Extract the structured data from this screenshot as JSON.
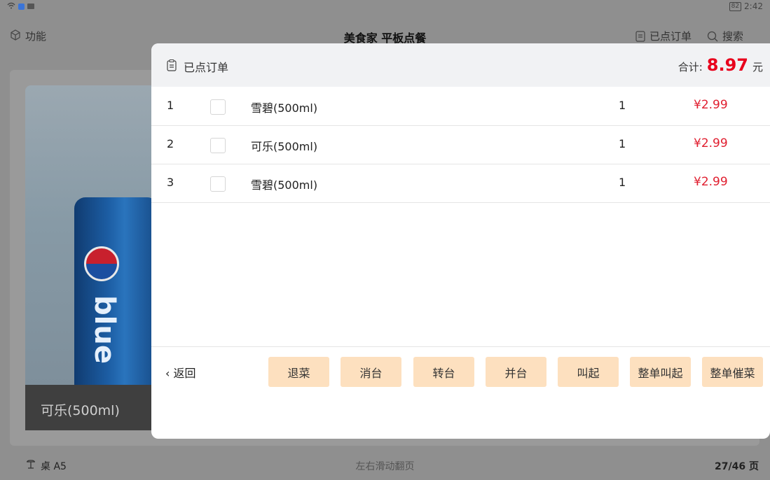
{
  "status_bar": {
    "battery": "82",
    "time": "2:42"
  },
  "top_bar": {
    "function_label": "功能",
    "title": "美食家 平板点餐",
    "orders_label": "已点订单",
    "search_label": "搜索"
  },
  "background": {
    "product_name": "可乐(500ml)",
    "can_text": "blue"
  },
  "bottom_bar": {
    "table_label": "桌 A5",
    "hint": "左右滑动翻页",
    "page": "27/46 页"
  },
  "dialog": {
    "title": "已点订单",
    "total_label": "合计:",
    "total_amount": "8.97",
    "total_unit": "元",
    "rows": [
      {
        "index": "1",
        "name": "雪碧(500ml)",
        "qty": "1",
        "price": "¥2.99"
      },
      {
        "index": "2",
        "name": "可乐(500ml)",
        "qty": "1",
        "price": "¥2.99"
      },
      {
        "index": "3",
        "name": "雪碧(500ml)",
        "qty": "1",
        "price": "¥2.99"
      }
    ],
    "back_label": "返回",
    "actions": [
      "退菜",
      "消台",
      "转台",
      "并台",
      "叫起",
      "整单叫起",
      "整单催菜"
    ]
  },
  "colors": {
    "accent_red": "#e8001c",
    "button_bg": "#fde0bf"
  }
}
